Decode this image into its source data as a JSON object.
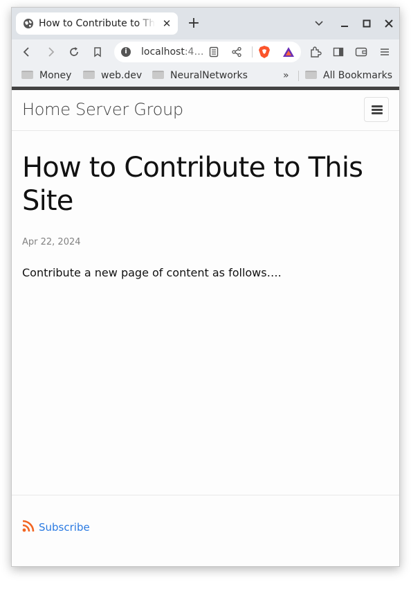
{
  "browser": {
    "tab_title": "How to Contribute to This Site",
    "url_host": "localhost",
    "url_rest": ":4…",
    "bookmarks": [
      {
        "label": "Money"
      },
      {
        "label": "web.dev"
      },
      {
        "label": "NeuralNetworks"
      }
    ],
    "all_bookmarks_label": "All Bookmarks",
    "overflow_label": "»"
  },
  "site": {
    "title": "Home Server Group"
  },
  "post": {
    "title": "How to Contribute to This Site",
    "date": "Apr 22, 2024",
    "body": "Contribute a new page of content as follows…."
  },
  "footer": {
    "subscribe_label": "Subscribe"
  },
  "colors": {
    "link": "#2a7ae2",
    "rss": "#f26522",
    "brave": "#fb542b",
    "header_bar": "#424242"
  }
}
